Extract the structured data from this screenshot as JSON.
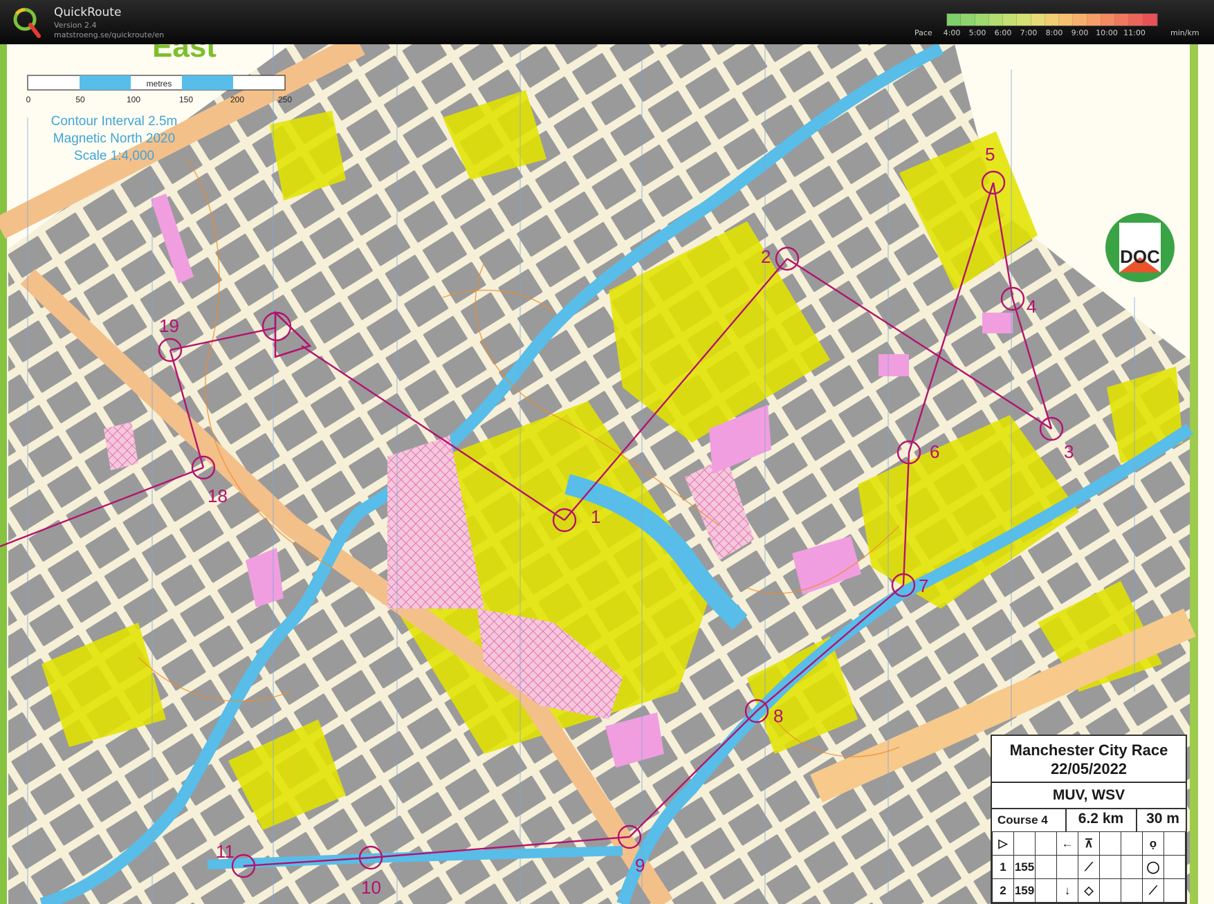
{
  "app": {
    "name": "QuickRoute",
    "version": "Version 2.4",
    "url": "matstroeng.se/quickroute/en"
  },
  "pace": {
    "label": "Pace",
    "ticks": [
      "4:00",
      "5:00",
      "6:00",
      "7:00",
      "8:00",
      "9:00",
      "10:00",
      "11:00"
    ],
    "unit": "min/km",
    "colors": [
      "#7fcf6a",
      "#8ed46c",
      "#9fd96e",
      "#b2dd70",
      "#c4e072",
      "#d6e174",
      "#e6dc75",
      "#f0cf74",
      "#f4c071",
      "#f6b06c",
      "#f59e67",
      "#f38b62",
      "#f0785e",
      "#ec655a",
      "#e85257"
    ]
  },
  "map": {
    "scale_bar": {
      "unit": "metres",
      "ticks": [
        "0",
        "50",
        "100",
        "150",
        "200",
        "250"
      ]
    },
    "info": [
      "Contour Interval 2.5m",
      "Magnetic North 2020",
      "Scale 1:4,000"
    ],
    "club_logo": "DOC",
    "partial_text": "East",
    "controls": [
      {
        "label": "1"
      },
      {
        "label": "2"
      },
      {
        "label": "3"
      },
      {
        "label": "4"
      },
      {
        "label": "5"
      },
      {
        "label": "6"
      },
      {
        "label": "7"
      },
      {
        "label": "8"
      },
      {
        "label": "9"
      },
      {
        "label": "10"
      },
      {
        "label": "11"
      },
      {
        "label": "18"
      },
      {
        "label": "19"
      }
    ],
    "course_color": "#b3126e"
  },
  "legend": {
    "race_name": "Manchester City Race",
    "date": "22/05/2022",
    "clubs": "MUV, WSV",
    "course": "Course 4",
    "length": "6.2 km",
    "climb": "30 m",
    "rows": [
      [
        "",
        "",
        "",
        "←",
        "",
        "",
        "",
        "",
        ""
      ],
      [
        "1",
        "155",
        "",
        "",
        "",
        "",
        "",
        "",
        ""
      ],
      [
        "2",
        "159",
        "",
        "↓",
        "",
        "",
        "",
        "",
        ""
      ]
    ]
  }
}
